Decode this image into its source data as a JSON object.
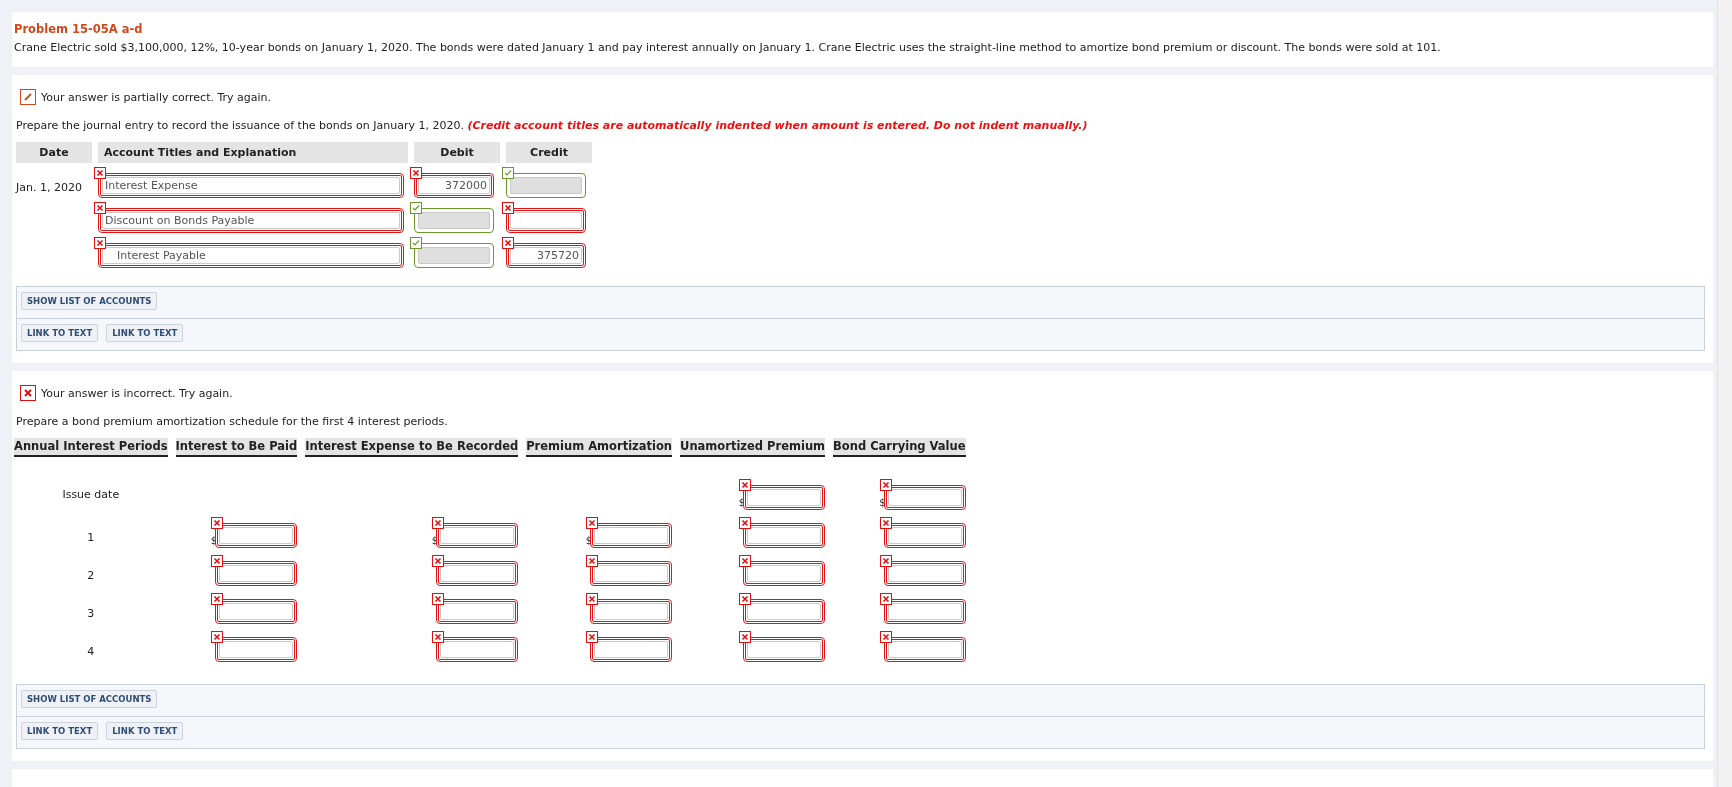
{
  "problem": {
    "title": "Problem 15-05A a-d",
    "text": "Crane Electric sold $3,100,000, 12%, 10-year bonds on January 1, 2020. The bonds were dated January 1 and pay interest annually on January 1. Crane Electric uses the straight-line method to amortize bond premium or discount. The bonds were sold at 101."
  },
  "journal_part": {
    "partial": true,
    "status_text": "Your answer is partially correct.  Try again.",
    "instruction": "Prepare the journal entry to record the issuance of the bonds on January 1, 2020.",
    "note": "(Credit account titles are automatically indented when amount is entered. Do not indent manually.)",
    "columns": [
      "Date",
      "Account Titles and Explanation",
      "Debit",
      "Credit"
    ],
    "rows": [
      {
        "date": "Jan. 1, 2020",
        "account": {
          "value": "Interest Expense",
          "correct": false,
          "indented": false
        },
        "debit": {
          "value": "372000",
          "correct": false
        },
        "credit": {
          "correct": true
        }
      },
      {
        "account": {
          "value": "Discount on Bonds Payable",
          "correct": false,
          "indented": false
        },
        "debit": {
          "correct": true
        },
        "credit": {
          "correct": false
        }
      },
      {
        "account": {
          "value": "Interest Payable",
          "correct": false,
          "indented": true
        },
        "debit": {
          "correct": true
        },
        "credit": {
          "value": "375720",
          "correct": false
        }
      }
    ],
    "buttons": [
      "SHOW LIST OF ACCOUNTS"
    ],
    "links": [
      "LINK TO TEXT",
      "LINK TO TEXT"
    ]
  },
  "schedule_part": {
    "partial": false,
    "status_text": "Your answer is incorrect.  Try again.",
    "instruction": "Prepare a bond premium amortization schedule for the first 4 interest periods.",
    "columns": [
      "Annual Interest Periods",
      "Interest to Be Paid",
      "Interest Expense to Be Recorded",
      "Premium Amortization",
      "Unamortized Premium",
      "Bond Carrying Value"
    ],
    "rows": [
      [
        "Issue date",
        "",
        "",
        "",
        {
          "correct": false,
          "prefix": "$"
        },
        {
          "correct": false,
          "prefix": "$"
        }
      ],
      [
        "1",
        {
          "correct": false,
          "prefix": "$"
        },
        {
          "correct": false,
          "prefix": "$"
        },
        {
          "correct": false,
          "prefix": "$"
        },
        {
          "correct": false
        },
        {
          "correct": false
        }
      ],
      [
        "2",
        {
          "correct": false
        },
        {
          "correct": false
        },
        {
          "correct": false
        },
        {
          "correct": false
        },
        {
          "correct": false
        }
      ],
      [
        "3",
        {
          "correct": false
        },
        {
          "correct": false
        },
        {
          "correct": false
        },
        {
          "correct": false
        },
        {
          "correct": false
        }
      ],
      [
        "4",
        {
          "correct": false
        },
        {
          "correct": false
        },
        {
          "correct": false
        },
        {
          "correct": false
        },
        {
          "correct": false
        }
      ]
    ],
    "buttons": [
      "SHOW LIST OF ACCOUNTS"
    ],
    "links": [
      "LINK TO TEXT",
      "LINK TO TEXT"
    ]
  }
}
